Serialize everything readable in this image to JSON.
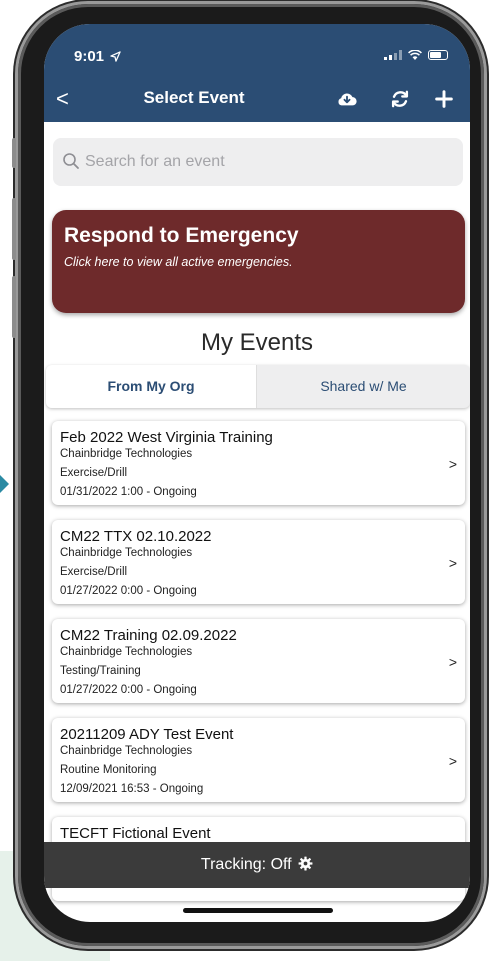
{
  "status_bar": {
    "time": "9:01"
  },
  "nav": {
    "back_label": "<",
    "title": "Select Event",
    "icons": [
      "cloud-download-icon",
      "refresh-icon",
      "plus-icon"
    ]
  },
  "search": {
    "placeholder": "Search for an event"
  },
  "emergency": {
    "title": "Respond to Emergency",
    "subtitle": "Click here to view all active emergencies.",
    "color": "#6e2a2b"
  },
  "section_title": "My Events",
  "tabs": [
    {
      "label": "From My Org",
      "active": true
    },
    {
      "label": "Shared w/ Me",
      "active": false
    }
  ],
  "events": [
    {
      "title": "Feb 2022 West Virginia Training",
      "org": "Chainbridge Technologies",
      "type": "Exercise/Drill",
      "date": "01/31/2022 1:00 - Ongoing"
    },
    {
      "title": "CM22 TTX 02.10.2022",
      "org": "Chainbridge Technologies",
      "type": "Exercise/Drill",
      "date": "01/27/2022 0:00 - Ongoing"
    },
    {
      "title": "CM22 Training 02.09.2022",
      "org": "Chainbridge Technologies",
      "type": "Testing/Training",
      "date": "01/27/2022 0:00 - Ongoing"
    },
    {
      "title": "20211209 ADY Test Event",
      "org": "Chainbridge Technologies",
      "type": "Routine Monitoring",
      "date": "12/09/2021 16:53 - Ongoing"
    },
    {
      "title": "TECFT Fictional Event"
    }
  ],
  "tracking": {
    "label": "Tracking:",
    "status": "Off"
  },
  "colors": {
    "header": "#2b4d74",
    "accent": "#2b4d74",
    "tracking_bar": "#3b3b3b"
  }
}
